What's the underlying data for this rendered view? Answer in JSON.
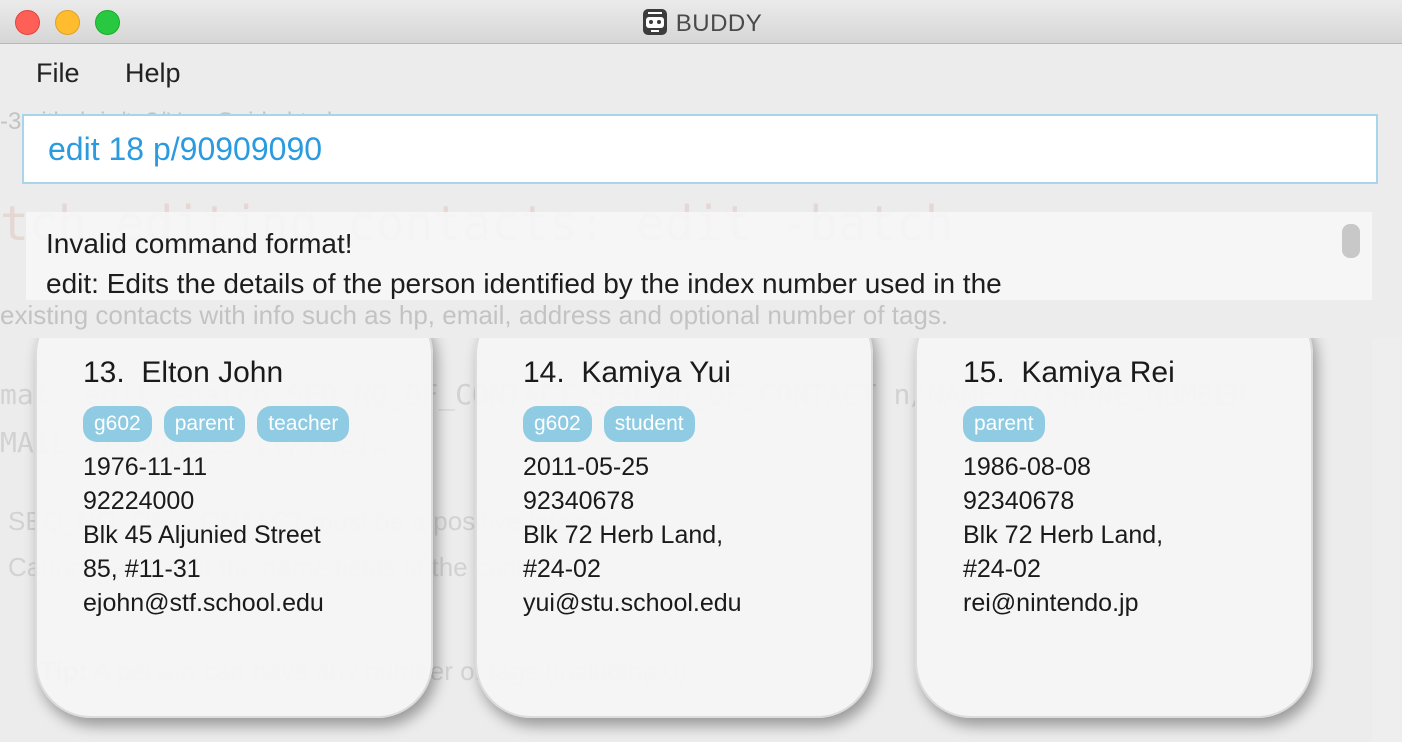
{
  "window": {
    "title": "BUDDY"
  },
  "menu": {
    "file": "File",
    "help": "Help"
  },
  "command": {
    "value": "edit 18 p/90909090"
  },
  "result": {
    "lines": [
      "Invalid command format!",
      "edit: Edits the details of the person identified by the index number used in the"
    ]
  },
  "background": {
    "url": "-3.github.io/tp2/UserGuide.html",
    "heading": "tch editing contacts: edit -batch",
    "line1": "existing contacts with info such as hp, email, address and optional number of tags.",
    "format1": "mat:  edit -batch SEQ_NO_OF_CONTACT,SEQ_NO_OF_CONTACT n/NAME p/PHONE_NUMBER",
    "format2": "MAIL a/ADDRESS [t/TAG]…",
    "li1": "SEQ_NO_OF_CONTACT must be a positive integer.",
    "li2": "Cannot batch edit the name fields of the contacts.",
    "tip_label": "Tip:",
    "tip_text": " A person can have any number of tags (including 0)"
  },
  "persons": [
    {
      "index": "13.",
      "name": "Elton John",
      "tags": [
        "g602",
        "parent",
        "teacher"
      ],
      "birthday": "1976-11-11",
      "phone": "92224000",
      "address_line1": "Blk 45 Aljunied Street",
      "address_line2": "85, #11-31",
      "email": "ejohn@stf.school.edu"
    },
    {
      "index": "14.",
      "name": "Kamiya Yui",
      "tags": [
        "g602",
        "student"
      ],
      "birthday": "2011-05-25",
      "phone": "92340678",
      "address_line1": "Blk 72 Herb Land,",
      "address_line2": "#24-02",
      "email": "yui@stu.school.edu"
    },
    {
      "index": "15.",
      "name": "Kamiya Rei",
      "tags": [
        "parent"
      ],
      "birthday": "1986-08-08",
      "phone": "92340678",
      "address_line1": "Blk 72 Herb Land,",
      "address_line2": "#24-02",
      "email": "rei@nintendo.jp"
    }
  ],
  "colors": {
    "accent": "#2b9be0",
    "tag": "#8fcbe3"
  }
}
